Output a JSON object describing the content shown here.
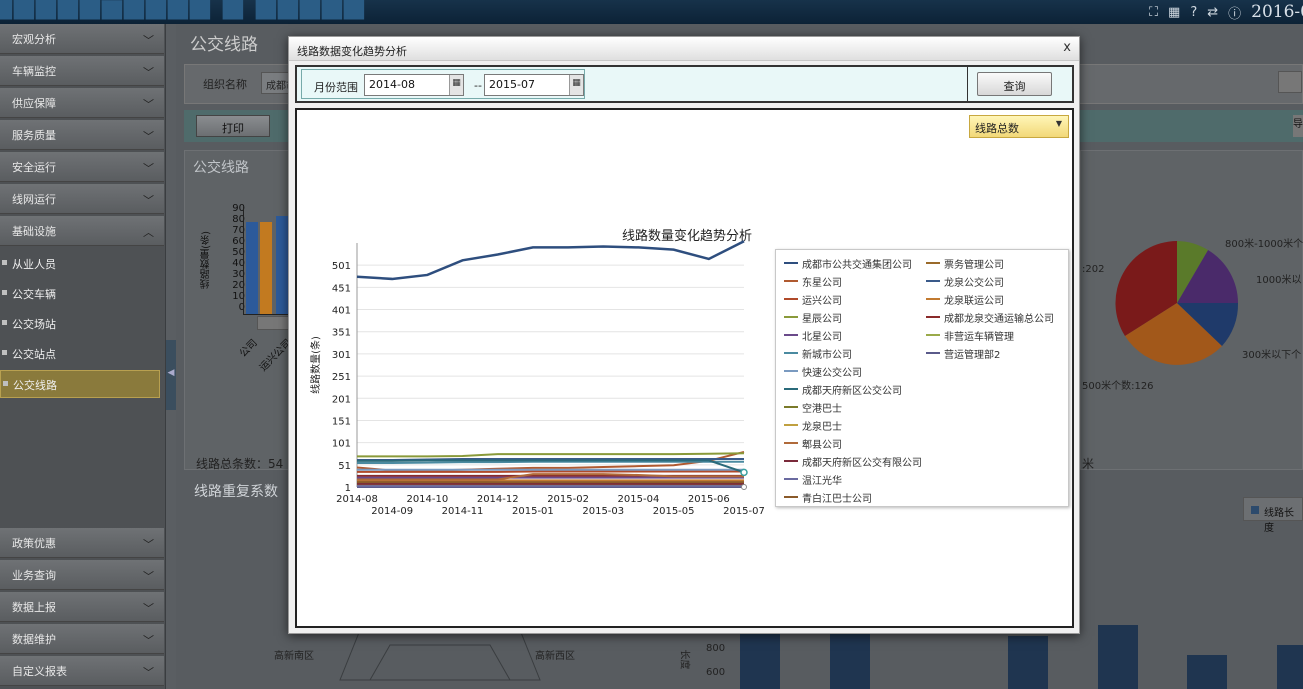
{
  "app": {
    "clock": "2016-0"
  },
  "sidebar": {
    "menu_top": [
      "宏观分析",
      "车辆监控",
      "供应保障",
      "服务质量",
      "安全运行",
      "线网运行",
      "基础设施"
    ],
    "sub_items": [
      "从业人员",
      "公交车辆",
      "公交场站",
      "公交站点",
      "公交线路"
    ],
    "active_sub": "公交线路",
    "menu_bottom": [
      "政策优惠",
      "业务查询",
      "数据上报",
      "数据维护",
      "自定义报表"
    ]
  },
  "main": {
    "title": "公交线路",
    "org_label": "组织名称",
    "org_value": "成都市",
    "print_label": "打印",
    "right_btn_label": "导",
    "panel_title": "公交线路",
    "mini_chart_ylabel": "线路数量(条)",
    "mini_chart_yticks": [
      "90",
      "80",
      "70",
      "60",
      "50",
      "40",
      "30",
      "20",
      "10",
      "0"
    ],
    "mini_chart_xlabels": [
      "公司",
      "运兴公司"
    ],
    "summary": "线路总条数：54",
    "dup_title": "线路重复系数",
    "pie_labels": [
      "800米-1000米个",
      "1000米以",
      "300米以下个",
      "500米个数:126",
      ":202"
    ],
    "unit_tail": "米",
    "length_legend": "线路长度",
    "radar_labels": [
      "高新南区",
      "高新西区"
    ],
    "bar_axis_label": "长度",
    "bar_yticks": [
      "800",
      "600"
    ]
  },
  "modal": {
    "title": "线路数据变化趋势分析",
    "close_label": "x",
    "filter_label": "月份范围",
    "date_from": "2014-08",
    "date_to": "2015-07",
    "date_sep": "--",
    "query_label": "查询",
    "metric_selected": "线路总数",
    "calendar_icon": "calendar-icon"
  },
  "chart_data": {
    "type": "line",
    "title": "线路数量变化趋势分析",
    "ylabel": "线路数量(条)",
    "xlabel": "",
    "x": [
      "2014-08",
      "2014-09",
      "2014-10",
      "2014-11",
      "2014-12",
      "2015-01",
      "2015-02",
      "2015-03",
      "2015-04",
      "2015-05",
      "2015-06",
      "2015-07"
    ],
    "yticks": [
      1,
      51,
      101,
      151,
      201,
      251,
      301,
      351,
      401,
      451,
      501
    ],
    "ylim": [
      1,
      551
    ],
    "grid": true,
    "legend_position": "right",
    "series": [
      {
        "name": "成都市公共交通集团公司",
        "color": "#2e4e7e",
        "values": [
          475,
          470,
          479,
          512,
          525,
          541,
          541,
          543,
          541,
          536,
          515,
          555
        ]
      },
      {
        "name": "票务管理公司",
        "color": "#9a6a2a",
        "values": [
          1,
          1,
          1,
          1,
          1,
          1,
          1,
          1,
          1,
          1,
          1,
          1
        ]
      },
      {
        "name": "东星公司",
        "color": "#b05a30",
        "values": [
          45,
          38,
          38,
          40,
          42,
          44,
          44,
          46,
          48,
          50,
          60,
          80
        ]
      },
      {
        "name": "龙泉公交公司",
        "color": "#3a5a8a",
        "values": [
          62,
          62,
          63,
          64,
          64,
          64,
          64,
          64,
          64,
          64,
          64,
          64
        ]
      },
      {
        "name": "运兴公司",
        "color": "#b04a2a",
        "values": [
          35,
          35,
          35,
          35,
          35,
          36,
          36,
          36,
          36,
          36,
          36,
          36
        ]
      },
      {
        "name": "龙泉联运公司",
        "color": "#c27a30",
        "values": [
          15,
          15,
          15,
          15,
          16,
          16,
          16,
          16,
          16,
          16,
          16,
          16
        ]
      },
      {
        "name": "星辰公司",
        "color": "#8a9a3a",
        "values": [
          70,
          70,
          70,
          71,
          75,
          75,
          75,
          75,
          75,
          75,
          76,
          77
        ]
      },
      {
        "name": "成都龙泉交通运输总公司",
        "color": "#8a2a2a",
        "values": [
          26,
          26,
          26,
          26,
          26,
          26,
          26,
          26,
          26,
          26,
          26,
          26
        ]
      },
      {
        "name": "北星公司",
        "color": "#6a4a8a",
        "values": [
          22,
          22,
          22,
          22,
          22,
          22,
          22,
          22,
          22,
          22,
          22,
          22
        ]
      },
      {
        "name": "非营运车辆管理",
        "color": "#9aaa4a",
        "values": [
          1,
          1,
          1,
          1,
          1,
          1,
          1,
          1,
          1,
          1,
          1,
          1
        ]
      },
      {
        "name": "新城市公司",
        "color": "#4a8aa0",
        "values": [
          55,
          55,
          56,
          57,
          57,
          58,
          58,
          58,
          58,
          58,
          58,
          58
        ]
      },
      {
        "name": "营运管理部2",
        "color": "#5a5a8a",
        "values": [
          1,
          1,
          1,
          1,
          1,
          1,
          1,
          1,
          1,
          1,
          1,
          1
        ]
      },
      {
        "name": "快速公交公司",
        "color": "#7a9ac0",
        "values": [
          40,
          40,
          40,
          40,
          40,
          40,
          40,
          40,
          40,
          40,
          40,
          40
        ]
      },
      {
        "name": "成都天府新区公交公司",
        "color": "#2a6a7a",
        "values": [
          60,
          60,
          61,
          61,
          61,
          61,
          61,
          61,
          61,
          61,
          61,
          34
        ]
      },
      {
        "name": "空港巴士",
        "color": "#7a7a2a",
        "values": [
          10,
          10,
          10,
          10,
          10,
          10,
          10,
          10,
          10,
          10,
          10,
          10
        ]
      },
      {
        "name": "龙泉巴士",
        "color": "#c0a040",
        "values": [
          5,
          5,
          5,
          5,
          5,
          5,
          5,
          5,
          5,
          5,
          5,
          5
        ]
      },
      {
        "name": "郫县公司",
        "color": "#b06a3a",
        "values": [
          18,
          18,
          18,
          18,
          18,
          30,
          30,
          30,
          28,
          25,
          25,
          25
        ]
      },
      {
        "name": "成都天府新区公交有限公司",
        "color": "#7a2a3a",
        "values": [
          8,
          8,
          8,
          8,
          8,
          8,
          8,
          8,
          8,
          8,
          8,
          8
        ]
      },
      {
        "name": "温江光华",
        "color": "#6a6aa0",
        "values": [
          3,
          3,
          3,
          3,
          3,
          3,
          3,
          3,
          3,
          3,
          3,
          3
        ]
      },
      {
        "name": "青白江巴士公司",
        "color": "#8a5a2a",
        "values": [
          12,
          12,
          12,
          12,
          12,
          12,
          12,
          12,
          12,
          12,
          12,
          12
        ]
      }
    ]
  }
}
